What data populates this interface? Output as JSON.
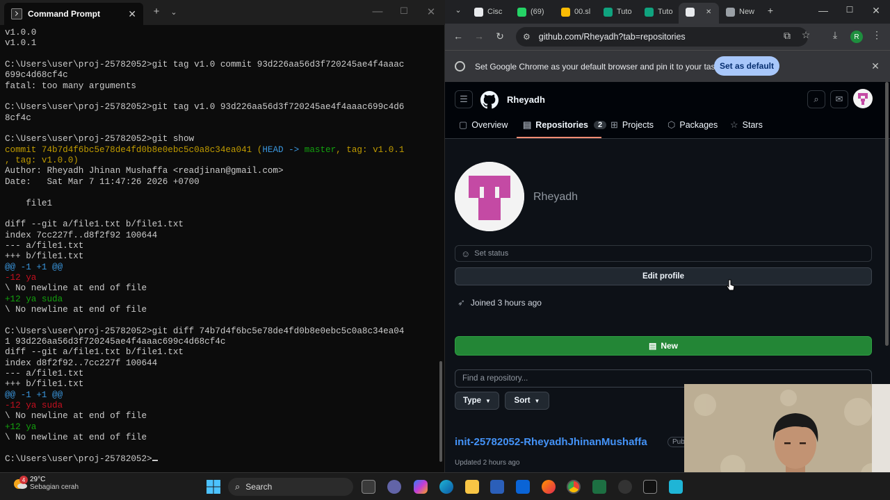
{
  "cmd": {
    "tab_title": "Command Prompt",
    "lines": [
      [
        {
          "t": "v1.0.0"
        }
      ],
      [
        {
          "t": "v1.0.1"
        }
      ],
      [
        {
          "t": ""
        }
      ],
      [
        {
          "t": "C:\\Users\\user\\proj-25782052>git tag v1.0 commit 93d226aa56d3f720245ae4f4aaac"
        }
      ],
      [
        {
          "t": "699c4d68cf4c"
        }
      ],
      [
        {
          "t": "fatal: too many arguments"
        }
      ],
      [
        {
          "t": ""
        }
      ],
      [
        {
          "t": "C:\\Users\\user\\proj-25782052>git tag v1.0 93d226aa56d3f720245ae4f4aaac699c4d6"
        }
      ],
      [
        {
          "t": "8cf4c"
        }
      ],
      [
        {
          "t": ""
        }
      ],
      [
        {
          "t": "C:\\Users\\user\\proj-25782052>git show"
        }
      ],
      [
        {
          "t": "commit 74b7d4f6bc5e78de4fd0b8e0ebc5c0a8c34ea041 ",
          "c": "yellow"
        },
        {
          "t": "(",
          "c": "yellow"
        },
        {
          "t": "HEAD -> ",
          "c": "cyan"
        },
        {
          "t": "master",
          "c": "green"
        },
        {
          "t": ", ",
          "c": "yellow"
        },
        {
          "t": "tag: v1.0.1",
          "c": "yellow"
        }
      ],
      [
        {
          "t": ", tag: v1.0.0)",
          "c": "yellow"
        }
      ],
      [
        {
          "t": "Author: Rheyadh Jhinan Mushaffa <readjinan@gmail.com>"
        }
      ],
      [
        {
          "t": "Date:   Sat Mar 7 11:47:26 2026 +0700"
        }
      ],
      [
        {
          "t": ""
        }
      ],
      [
        {
          "t": "    file1"
        }
      ],
      [
        {
          "t": ""
        }
      ],
      [
        {
          "t": "diff --git a/file1.txt b/file1.txt"
        }
      ],
      [
        {
          "t": "index 7cc227f..d8f2f92 100644"
        }
      ],
      [
        {
          "t": "--- a/file1.txt"
        }
      ],
      [
        {
          "t": "+++ b/file1.txt"
        }
      ],
      [
        {
          "t": "@@ -1 +1 @@",
          "c": "cyan"
        }
      ],
      [
        {
          "t": "-12 ya",
          "c": "red"
        }
      ],
      [
        {
          "t": "\\ No newline at end of file"
        }
      ],
      [
        {
          "t": "+12 ya suda",
          "c": "green"
        }
      ],
      [
        {
          "t": "\\ No newline at end of file"
        }
      ],
      [
        {
          "t": ""
        }
      ],
      [
        {
          "t": "C:\\Users\\user\\proj-25782052>git diff 74b7d4f6bc5e78de4fd0b8e0ebc5c0a8c34ea04"
        }
      ],
      [
        {
          "t": "1 93d226aa56d3f720245ae4f4aaac699c4d68cf4c"
        }
      ],
      [
        {
          "t": "diff --git a/file1.txt b/file1.txt"
        }
      ],
      [
        {
          "t": "index d8f2f92..7cc227f 100644"
        }
      ],
      [
        {
          "t": "--- a/file1.txt"
        }
      ],
      [
        {
          "t": "+++ b/file1.txt"
        }
      ],
      [
        {
          "t": "@@ -1 +1 @@",
          "c": "cyan"
        }
      ],
      [
        {
          "t": "-12 ya suda",
          "c": "red"
        }
      ],
      [
        {
          "t": "\\ No newline at end of file"
        }
      ],
      [
        {
          "t": "+12 ya",
          "c": "green"
        }
      ],
      [
        {
          "t": "\\ No newline at end of file"
        }
      ],
      [
        {
          "t": ""
        }
      ],
      [
        {
          "t": "C:\\Users\\user\\proj-25782052>"
        }
      ]
    ]
  },
  "chrome": {
    "tabs": [
      {
        "label": "Cisc",
        "color": "#e8eaed"
      },
      {
        "label": "(69)",
        "color": "#25d366"
      },
      {
        "label": "00.sl",
        "color": "#fbbc04"
      },
      {
        "label": "Tuto",
        "color": "#10a37f"
      },
      {
        "label": "Tuto",
        "color": "#10a37f"
      },
      {
        "label": "",
        "color": "#e8eaed"
      },
      {
        "label": "New",
        "color": "#9aa0a6"
      }
    ],
    "url": "github.com/Rheyadh?tab=repositories",
    "profile_letter": "R",
    "infobar_message": "Set Google Chrome as your default browser and pin it to your taskbar",
    "infobar_button": "Set as default"
  },
  "github": {
    "username": "Rheyadh",
    "nav": [
      {
        "label": "Overview",
        "count": ""
      },
      {
        "label": "Repositories",
        "count": "2"
      },
      {
        "label": "Projects",
        "count": ""
      },
      {
        "label": "Packages",
        "count": ""
      },
      {
        "label": "Stars",
        "count": ""
      }
    ],
    "display_name": "Rheyadh",
    "set_status": "Set status",
    "edit_profile": "Edit profile",
    "joined": "Joined 3 hours ago",
    "new_button": "New",
    "find_placeholder": "Find a repository...",
    "type_button": "Type",
    "sort_button": "Sort",
    "repo_name": "init-25782052-RheyadhJhinanMushaffa",
    "repo_badge": "Public",
    "repo_updated": "Updated 2 hours ago"
  },
  "taskbar": {
    "temperature": "29°C",
    "weather": "Sebagian cerah",
    "notification_count": "4",
    "search_label": "Search"
  }
}
